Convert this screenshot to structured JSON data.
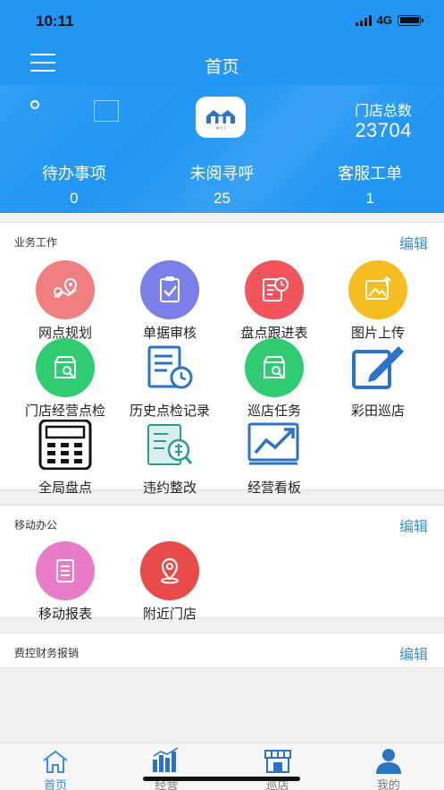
{
  "status": {
    "time": "10:11",
    "network": "4G"
  },
  "header": {
    "title": "首页"
  },
  "summary": {
    "store_label": "门店总数",
    "store_count": "23704",
    "stats": [
      {
        "label": "待办事项",
        "value": "0"
      },
      {
        "label": "未阅寻呼",
        "value": "25"
      },
      {
        "label": "客服工单",
        "value": "1"
      }
    ]
  },
  "logo_text": "M.Y.J",
  "sections": {
    "business": {
      "title": "业务工作",
      "edit": "编辑",
      "items": [
        {
          "label": "网点规划",
          "icon": "map-pin-icon",
          "color": "#f08080"
        },
        {
          "label": "单据审核",
          "icon": "clipboard-check-icon",
          "color": "#7b7fe8"
        },
        {
          "label": "盘点跟进表",
          "icon": "document-clock-icon",
          "color": "#f2545b"
        },
        {
          "label": "图片上传",
          "icon": "image-upload-icon",
          "color": "#f5bd1f"
        },
        {
          "label": "门店经营点检",
          "icon": "store-inspect-icon",
          "color": "#2fcc71"
        },
        {
          "label": "历史点检记录",
          "icon": "history-record-icon",
          "color": "#2a73c7"
        },
        {
          "label": "巡店任务",
          "icon": "patrol-task-icon",
          "color": "#2fcc71"
        },
        {
          "label": "彩田巡店",
          "icon": "edit-pen-icon",
          "color": "#2a73c7"
        },
        {
          "label": "全局盘点",
          "icon": "calculator-icon",
          "color": "#111111"
        },
        {
          "label": "违约整改",
          "icon": "violation-fix-icon",
          "color": "#2a9d8f"
        },
        {
          "label": "经营看板",
          "icon": "trend-board-icon",
          "color": "#2a73c7"
        }
      ]
    },
    "mobile": {
      "title": "移动办公",
      "edit": "编辑",
      "items": [
        {
          "label": "移动报表",
          "icon": "report-icon",
          "color": "#e97cc8"
        },
        {
          "label": "附近门店",
          "icon": "location-icon",
          "color": "#e94a4a"
        }
      ]
    },
    "expense": {
      "title": "费控财务报销",
      "edit": "编辑"
    }
  },
  "tabs": [
    {
      "label": "首页",
      "icon": "home-icon",
      "active": true
    },
    {
      "label": "经营",
      "icon": "bar-chart-icon",
      "active": false
    },
    {
      "label": "巡店",
      "icon": "store-icon",
      "active": false
    },
    {
      "label": "我的",
      "icon": "person-icon",
      "active": false
    }
  ],
  "colors": {
    "primary": "#2196f3",
    "accent": "#3a8fd8"
  }
}
